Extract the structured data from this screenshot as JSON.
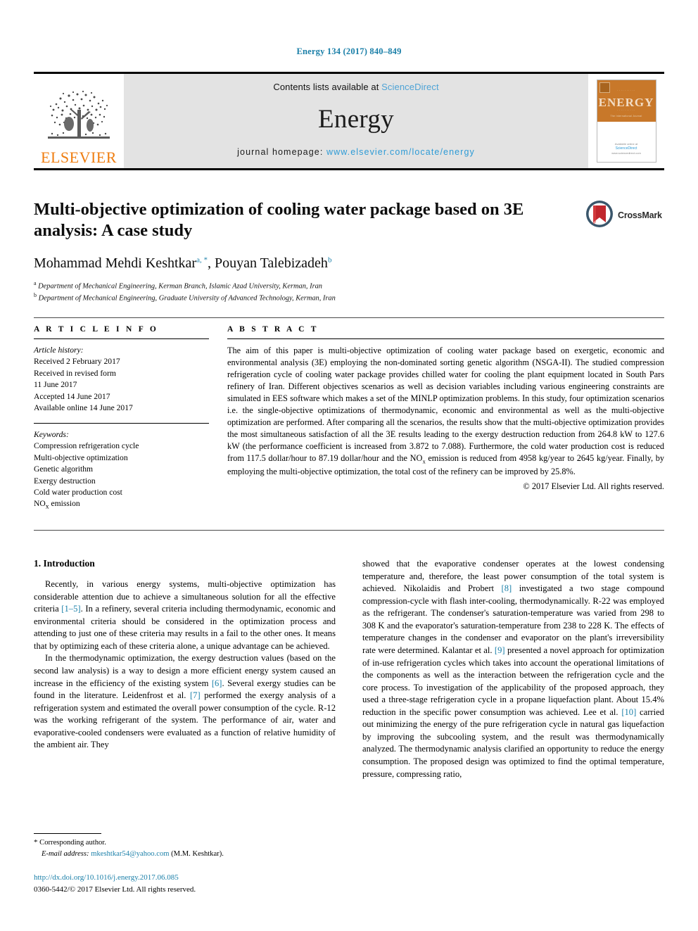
{
  "running_head": "Energy 134 (2017) 840–849",
  "masthead": {
    "publisher_name": "ELSEVIER",
    "contents_prefix": "Contents lists available at ",
    "contents_link": "ScienceDirect",
    "journal_name": "Energy",
    "homepage_prefix": "journal homepage: ",
    "homepage_url": "www.elsevier.com/locate/energy",
    "cover": {
      "title": "ENERGY",
      "top_line": "The International Journal",
      "footer_line_1": "Available online at",
      "footer_line_2": "ScienceDirect",
      "footer_line_3": "www.sciencedirect.com"
    }
  },
  "article": {
    "title": "Multi-objective optimization of cooling water package based on 3E analysis: A case study",
    "authors_html": "Mohammad Mehdi Keshtkar, Pouyan Talebizadeh",
    "author_1": "Mohammad Mehdi Keshtkar",
    "author_1_marks": "a, *",
    "author_2": "Pouyan Talebizadeh",
    "author_2_marks": "b",
    "affiliation_a_mark": "a",
    "affiliation_a": "Department of Mechanical Engineering, Kerman Branch, Islamic Azad University, Kerman, Iran",
    "affiliation_b_mark": "b",
    "affiliation_b": "Department of Mechanical Engineering, Graduate University of Advanced Technology, Kerman, Iran",
    "crossmark_label": "CrossMark"
  },
  "article_info": {
    "heading": "A R T I C L E   I N F O",
    "history_label": "Article history:",
    "history_lines": [
      "Received 2 February 2017",
      "Received in revised form",
      "11 June 2017",
      "Accepted 14 June 2017",
      "Available online 14 June 2017"
    ],
    "keywords_label": "Keywords:",
    "keywords": [
      "Compression refrigeration cycle",
      "Multi-objective optimization",
      "Genetic algorithm",
      "Exergy destruction",
      "Cold water production cost",
      "NOx emission"
    ],
    "keyword_nox_prefix": "NO",
    "keyword_nox_sub": "x",
    "keyword_nox_suffix": " emission"
  },
  "abstract": {
    "heading": "A B S T R A C T",
    "part_1": "The aim of this paper is multi-objective optimization of cooling water package based on exergetic, economic and environmental analysis (3E) employing the non-dominated sorting genetic algorithm (NSGA-II). The studied compression refrigeration cycle of cooling water package provides chilled water for cooling the plant equipment located in South Pars refinery of Iran. Different objectives scenarios as well as decision variables including various engineering constraints are simulated in EES software which makes a set of the MINLP optimization problems. In this study, four optimization scenarios i.e. the single-objective optimizations of thermodynamic, economic and environmental as well as the multi-objective optimization are performed. After comparing all the scenarios, the results show that the multi-objective optimization provides the most simultaneous satisfaction of all the 3E results leading to the exergy destruction reduction from 264.8 kW to 127.6 kW (the performance coefficient is increased from 3.872 to 7.088). Furthermore, the cold water production cost is reduced from 117.5 dollar/hour to 87.19 dollar/hour and the NO",
    "nox_sub": "x",
    "part_2": " emission is reduced from 4958 kg/year to 2645 kg/year. Finally, by employing the multi-objective optimization, the total cost of the refinery can be improved by 25.8%.",
    "copyright": "© 2017 Elsevier Ltd. All rights reserved."
  },
  "body": {
    "section_number_title": "1. Introduction",
    "left_column": {
      "p1_a": "Recently, in various energy systems, multi-objective optimization has considerable attention due to achieve a simultaneous solution for all the effective criteria ",
      "p1_ref": "[1–5]",
      "p1_b": ". In a refinery, several criteria including thermodynamic, economic and environmental criteria should be considered in the optimization process and attending to just one of these criteria may results in a fail to the other ones. It means that by optimizing each of these criteria alone, a unique advantage can be achieved.",
      "p2_a": "In the thermodynamic optimization, the exergy destruction values (based on the second law analysis) is a way to design a more efficient energy system caused an increase in the efficiency of the existing system ",
      "p2_ref1": "[6]",
      "p2_b": ". Several exergy studies can be found in the literature. Leidenfrost et al. ",
      "p2_ref2": "[7]",
      "p2_c": " performed the exergy analysis of a refrigeration system and estimated the overall power consumption of the cycle. R-12 was the working refrigerant of the system. The performance of air, water and evaporative-cooled condensers were evaluated as a function of relative humidity of the ambient air. They"
    },
    "right_column": {
      "p_a": "showed that the evaporative condenser operates at the lowest condensing temperature and, therefore, the least power consumption of the total system is achieved. Nikolaidis and Probert ",
      "p_ref1": "[8]",
      "p_b": " investigated a two stage compound compression-cycle with flash inter-cooling, thermodynamically. R-22 was employed as the refrigerant. The condenser's saturation-temperature was varied from 298 to 308 K and the evaporator's saturation-temperature from 238 to 228 K. The effects of temperature changes in the condenser and evaporator on the plant's irreversibility rate were determined. Kalantar et al. ",
      "p_ref2": "[9]",
      "p_c": " presented a novel approach for optimization of in-use refrigeration cycles which takes into account the operational limitations of the components as well as the interaction between the refrigeration cycle and the core process. To investigation of the applicability of the proposed approach, they used a three-stage refrigeration cycle in a propane liquefaction plant. About 15.4% reduction in the specific power consumption was achieved. Lee et al. ",
      "p_ref3": "[10]",
      "p_d": " carried out minimizing the energy of the pure refrigeration cycle in natural gas liquefaction by improving the subcooling system, and the result was thermodynamically analyzed. The thermodynamic analysis clarified an opportunity to reduce the energy consumption. The proposed design was optimized to find the optimal temperature, pressure, compressing ratio,"
    }
  },
  "footnote": {
    "star": "*",
    "corresponding": "Corresponding author.",
    "email_label": "E-mail address:",
    "email": "mkeshtkar54@yahoo.com",
    "email_owner": "(M.M. Keshtkar)."
  },
  "page_footer": {
    "doi": "http://dx.doi.org/10.1016/j.energy.2017.06.085",
    "issn_line": "0360-5442/© 2017 Elsevier Ltd. All rights reserved."
  },
  "colors": {
    "link_blue": "#1a7fa8",
    "sciencedirect_blue": "#4ea3d6",
    "elsevier_orange": "#ef7d10",
    "cover_orange": "#c8782a",
    "masthead_gray": "#e3e3e3"
  }
}
